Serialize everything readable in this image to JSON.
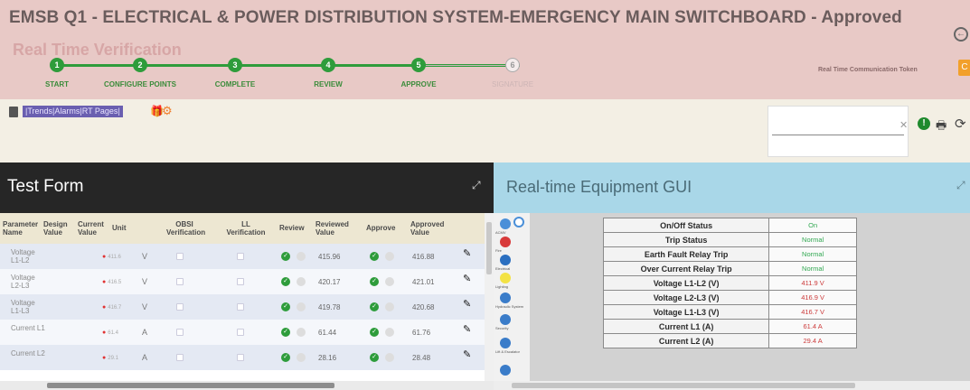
{
  "header": {
    "title": "EMSB Q1 - ELECTRICAL & POWER DISTRIBUTION SYSTEM-EMERGENCY MAIN SWITCHBOARD - Approved",
    "subtitle": "Real Time Verification",
    "token_label": "Real Time Communication Token",
    "steps": [
      {
        "num": "1",
        "label": "START",
        "done": true
      },
      {
        "num": "2",
        "label": "CONFIGURE POINTS",
        "done": true
      },
      {
        "num": "3",
        "label": "COMPLETE",
        "done": true
      },
      {
        "num": "4",
        "label": "REVIEW",
        "done": true
      },
      {
        "num": "5",
        "label": "APPROVE",
        "done": true
      },
      {
        "num": "6",
        "label": "SIGNATURE",
        "done": false
      }
    ]
  },
  "toolbar": {
    "links": [
      "Trends",
      "Alarms",
      "RT Pages"
    ]
  },
  "test_form": {
    "title": "Test Form",
    "columns": [
      "Parameter Name",
      "Design Value",
      "Current Value",
      "Unit",
      "OBSI Verification",
      "LL Verification",
      "Review",
      "Reviewed Value",
      "Approve",
      "Approved Value"
    ],
    "rows": [
      {
        "name": "Voltage L1-L2",
        "current": "411.6",
        "unit": "V",
        "reviewed": "415.96",
        "approved": "416.88"
      },
      {
        "name": "Voltage L2-L3",
        "current": "416.5",
        "unit": "V",
        "reviewed": "420.17",
        "approved": "421.01"
      },
      {
        "name": "Voltage L1-L3",
        "current": "416.7",
        "unit": "V",
        "reviewed": "419.78",
        "approved": "420.68"
      },
      {
        "name": "Current L1",
        "current": "61.4",
        "unit": "A",
        "reviewed": "61.44",
        "approved": "61.76"
      },
      {
        "name": "Current L2",
        "current": "29.1",
        "unit": "A",
        "reviewed": "28.16",
        "approved": "28.48"
      }
    ]
  },
  "realtime": {
    "title": "Real-time Equipment GUI",
    "side_labels": [
      "ACMV",
      "Fire",
      "Electrical",
      "Lighting",
      "Hydraulic System",
      "Security",
      "Lift & Escalator"
    ],
    "status": [
      {
        "label": "On/Off Status",
        "value": "On"
      },
      {
        "label": "Trip Status",
        "value": "Normal"
      },
      {
        "label": "Earth Fault Relay Trip",
        "value": "Normal"
      },
      {
        "label": "Over Current Relay Trip",
        "value": "Normal"
      },
      {
        "label": "Voltage L1-L2 (V)",
        "value": "411.9 V"
      },
      {
        "label": "Voltage L2-L3 (V)",
        "value": "416.9 V"
      },
      {
        "label": "Voltage L1-L3 (V)",
        "value": "416.7 V"
      },
      {
        "label": "Current L1 (A)",
        "value": "61.4 A"
      },
      {
        "label": "Current L2 (A)",
        "value": "29.4 A"
      }
    ]
  }
}
